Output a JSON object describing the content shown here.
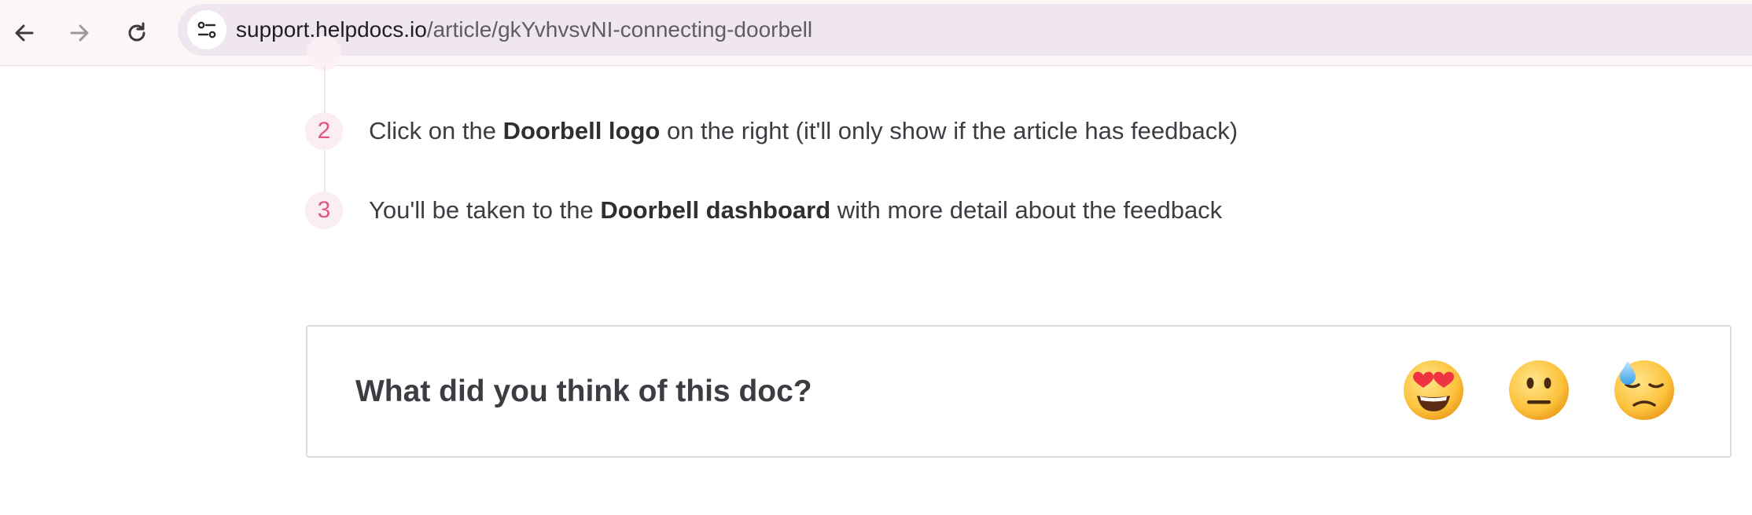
{
  "browser": {
    "back_icon": "arrow-left-icon",
    "forward_icon": "arrow-right-icon",
    "reload_icon": "reload-icon",
    "site_info_icon": "tune-icon",
    "url_host": "support.helpdocs.io",
    "url_path": "/article/gkYvhvsvNI-connecting-doorbell"
  },
  "steps": [
    {
      "number": "2",
      "before": "Click on the ",
      "bold": "Doorbell logo",
      "after": " on the right (it'll only show if the article has feedback)"
    },
    {
      "number": "3",
      "before": "You'll be taken to the ",
      "bold": "Doorbell dashboard",
      "after": " with more detail about the feedback"
    }
  ],
  "feedback": {
    "question": "What did you think of this doc?",
    "options": [
      {
        "icon": "heart-eyes-emoji-icon"
      },
      {
        "icon": "neutral-face-emoji-icon"
      },
      {
        "icon": "downcast-sweat-emoji-icon"
      }
    ]
  },
  "colors": {
    "accent_pink": "#e0568a",
    "toolbar_bg": "#fdf6f6",
    "omnibox_bg": "#efe6ef"
  }
}
